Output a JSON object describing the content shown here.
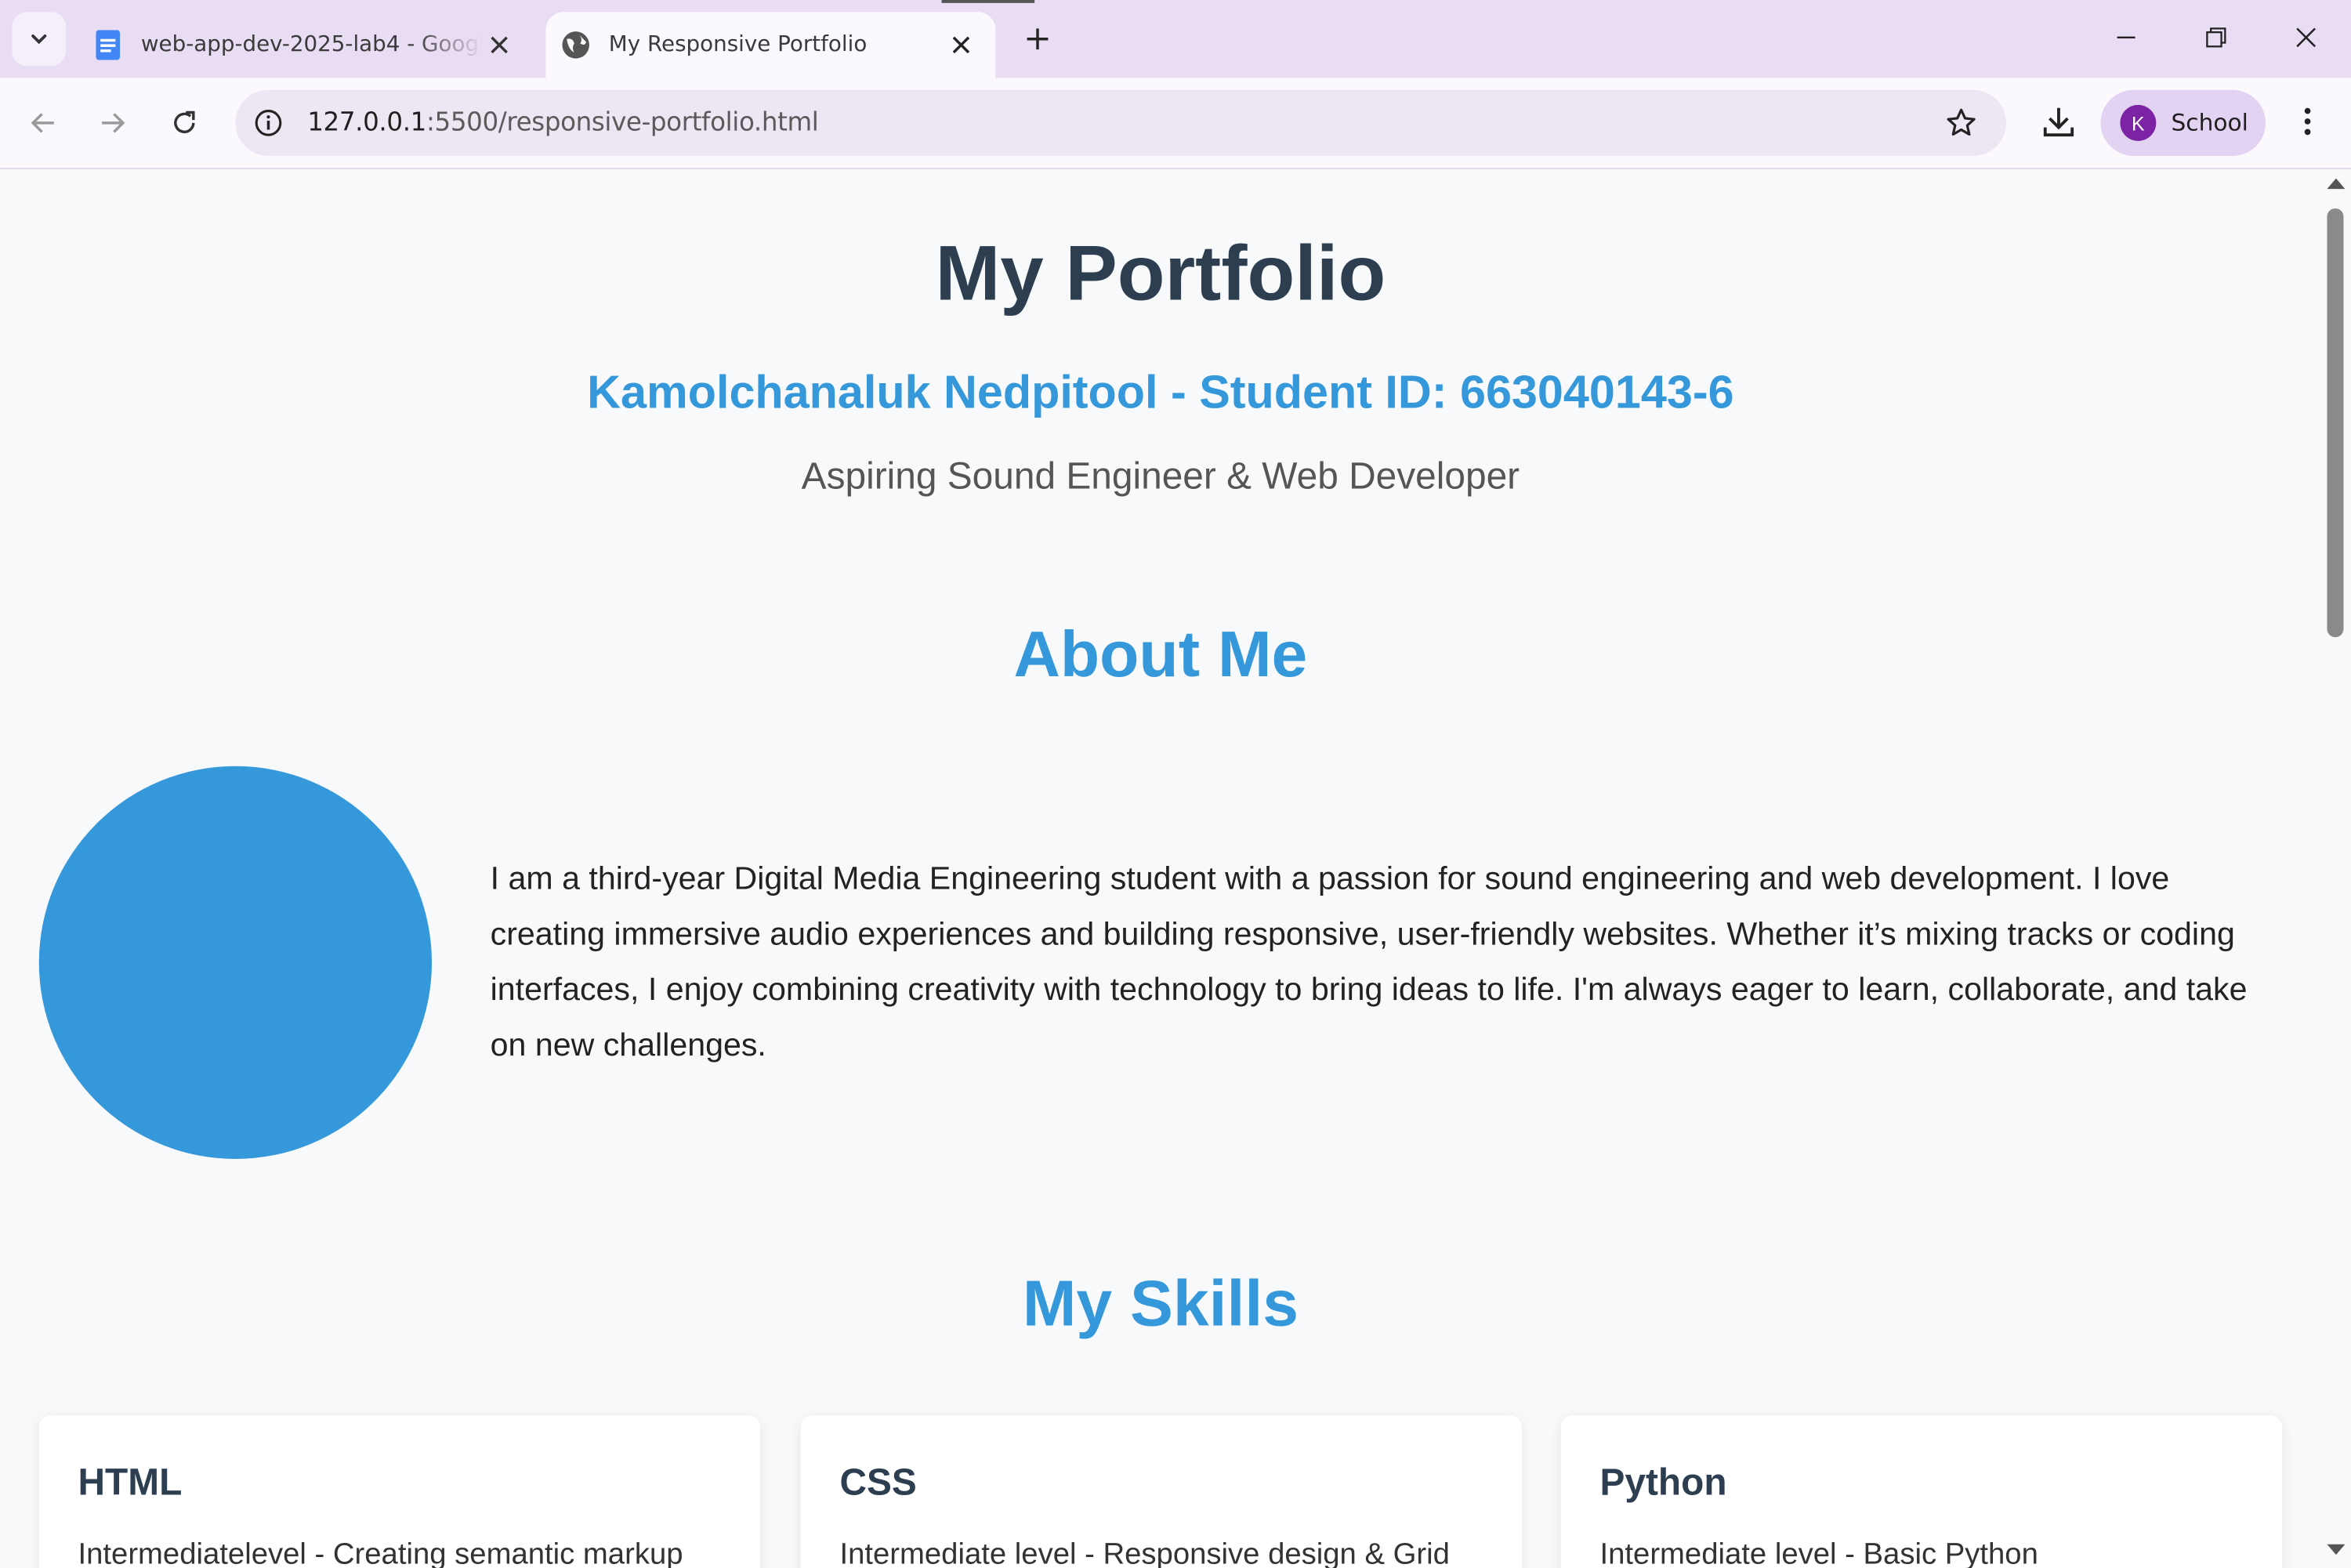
{
  "browser": {
    "tabs": [
      {
        "title": "web-app-dev-2025-lab4 - Google Docs",
        "icon": "google-docs-icon",
        "active": false
      },
      {
        "title": "My Responsive Portfolio",
        "icon": "globe-icon",
        "active": true
      }
    ],
    "address": {
      "host": "127.0.0.1",
      "rest": ":5500/responsive-portfolio.html"
    },
    "profile": {
      "initial": "K",
      "name": "School"
    }
  },
  "page": {
    "title": "My Portfolio",
    "student": "Kamolchanaluk Nedpitool - Student ID: 663040143-6",
    "tagline": "Aspiring Sound Engineer & Web Developer",
    "about": {
      "heading": "About Me",
      "text": "I am a third-year Digital Media Engineering student with a passion for sound engineering and web development. I love creating immersive audio experiences and building responsive, user-friendly websites. Whether it’s mixing tracks or coding interfaces, I enjoy combining creativity with technology to bring ideas to life. I'm always eager to learn, collaborate, and take on new challenges."
    },
    "skills": {
      "heading": "My Skills",
      "cards": [
        {
          "title": "HTML",
          "desc": "Intermediatelevel - Creating semantic markup"
        },
        {
          "title": "CSS",
          "desc": "Intermediate level - Responsive design & Grid"
        },
        {
          "title": "Python",
          "desc": "Intermediate level - Basic Python"
        }
      ]
    }
  },
  "colors": {
    "accent": "#3498db",
    "heading": "#2c3e50",
    "avatar": "#7b22a5",
    "tabstrip": "#e9ddf4"
  }
}
